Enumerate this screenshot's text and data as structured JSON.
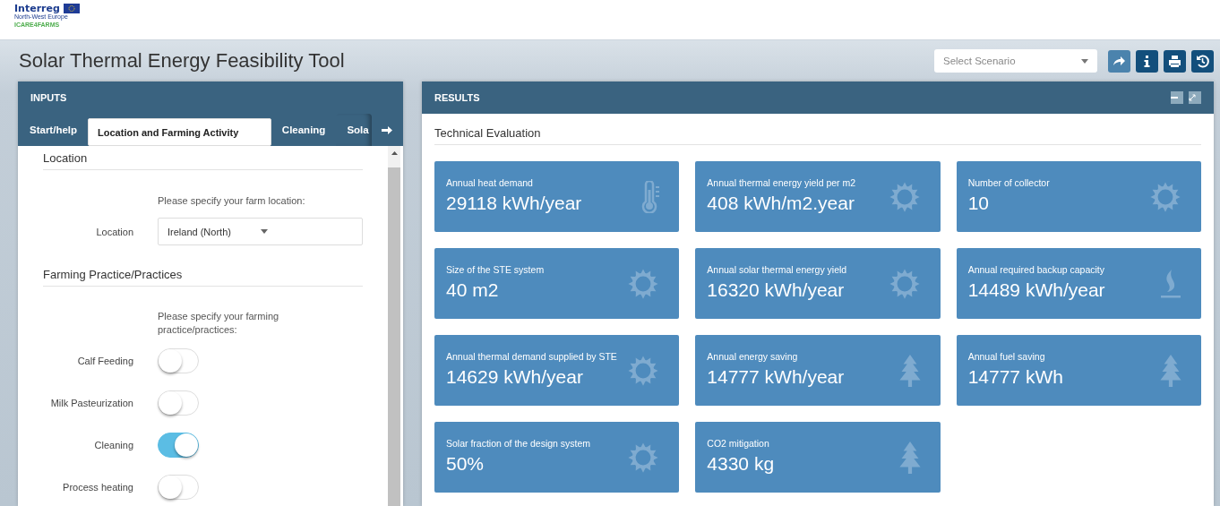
{
  "logo": {
    "brand": "Interreg",
    "region": "North-West Europe",
    "project": "ICARE4FARMS"
  },
  "title": "Solar Thermal Energy Feasibility Tool",
  "toolbar": {
    "scenario_placeholder": "Select Scenario"
  },
  "inputs": {
    "title": "INPUTS",
    "tabs": [
      {
        "label": "Start/help",
        "selected": false
      },
      {
        "label": "Location and Farming Activity",
        "selected": true
      },
      {
        "label": "Cleaning",
        "selected": false
      },
      {
        "label": "Sola",
        "selected": false
      }
    ],
    "sections": [
      {
        "heading": "Location",
        "hint": "Please specify your farm location:",
        "fields": [
          {
            "kind": "select",
            "label": "Location",
            "value": "Ireland (North)"
          }
        ]
      },
      {
        "heading": "Farming Practice/Practices",
        "hint": "Please specify your farming practice/practices:",
        "fields": [
          {
            "kind": "toggle",
            "label": "Calf Feeding",
            "on": false
          },
          {
            "kind": "toggle",
            "label": "Milk Pasteurization",
            "on": false
          },
          {
            "kind": "toggle",
            "label": "Cleaning",
            "on": true
          },
          {
            "kind": "toggle",
            "label": "Process heating",
            "on": false
          }
        ]
      }
    ]
  },
  "results": {
    "title": "RESULTS",
    "section": "Technical Evaluation",
    "cards": [
      {
        "kind": "demand",
        "label": "Annual heat demand",
        "value": "29118 kWh/year"
      },
      {
        "kind": "solar",
        "label": "Annual thermal energy yield per m2",
        "value": "408 kWh/m2.year"
      },
      {
        "kind": "solar",
        "label": "Number of collector",
        "value": "10"
      },
      {
        "kind": "solar",
        "label": "Size of the STE system",
        "value": "40 m2"
      },
      {
        "kind": "solar",
        "label": "Annual solar thermal energy yield",
        "value": "16320 kWh/year"
      },
      {
        "kind": "backup",
        "label": "Annual required backup capacity",
        "value": "14489 kWh/year"
      },
      {
        "kind": "solar",
        "label": "Annual thermal demand supplied by STE",
        "value": "14629 kWh/year"
      },
      {
        "kind": "saving",
        "label": "Annual energy saving",
        "value": "14777 kWh/year"
      },
      {
        "kind": "saving",
        "label": "Annual fuel saving",
        "value": "14777 kWh"
      },
      {
        "kind": "solar",
        "label": "Solar fraction of the design system",
        "value": "50%"
      },
      {
        "kind": "saving",
        "label": "CO2 mitigation",
        "value": "4330 kg"
      }
    ]
  }
}
